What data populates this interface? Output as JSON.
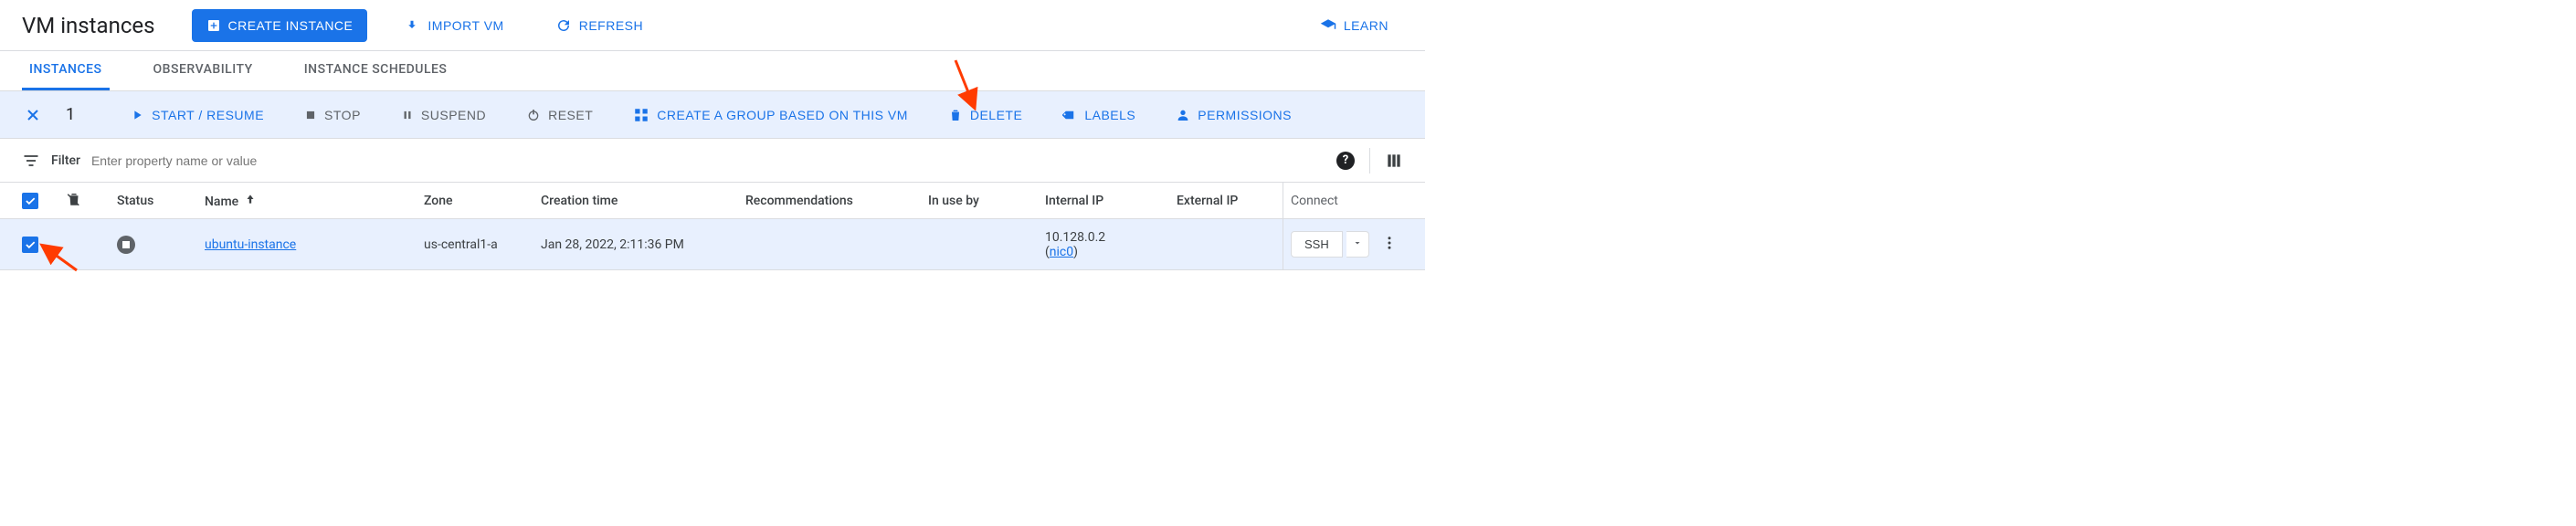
{
  "header": {
    "title": "VM instances",
    "create_label": "CREATE INSTANCE",
    "import_label": "IMPORT VM",
    "refresh_label": "REFRESH",
    "learn_label": "LEARN"
  },
  "tabs": {
    "instances": "INSTANCES",
    "observability": "OBSERVABILITY",
    "schedules": "INSTANCE SCHEDULES"
  },
  "action_bar": {
    "selected_count": "1",
    "start": "START / RESUME",
    "stop": "STOP",
    "suspend": "SUSPEND",
    "reset": "RESET",
    "group": "CREATE A GROUP BASED ON THIS VM",
    "delete": "DELETE",
    "labels": "LABELS",
    "permissions": "PERMISSIONS"
  },
  "filter": {
    "label": "Filter",
    "placeholder": "Enter property name or value"
  },
  "columns": {
    "status": "Status",
    "name": "Name",
    "zone": "Zone",
    "ctime": "Creation time",
    "rec": "Recommendations",
    "inuse": "In use by",
    "intip": "Internal IP",
    "extip": "External IP",
    "connect": "Connect"
  },
  "rows": [
    {
      "name": "ubuntu-instance",
      "zone": "us-central1-a",
      "ctime": "Jan 28, 2022, 2:11:36 PM",
      "intip": "10.128.0.2",
      "nic": "nic0",
      "ssh": "SSH"
    }
  ]
}
